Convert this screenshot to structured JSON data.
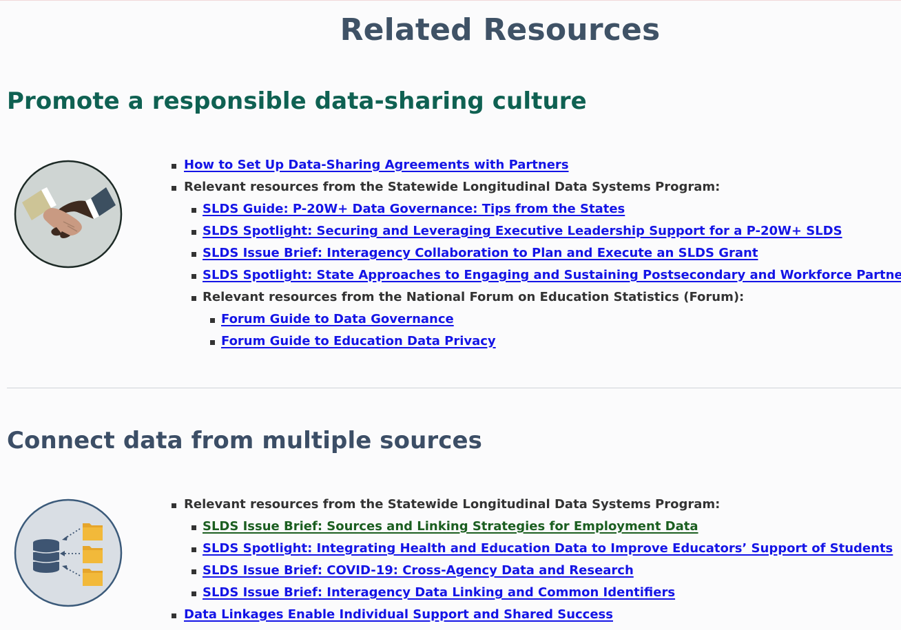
{
  "page": {
    "title": "Related Resources"
  },
  "section1": {
    "heading": "Promote a responsible data-sharing culture",
    "icon": "handshake-icon",
    "items": [
      "How to Set Up Data-Sharing Agreements with Partners",
      "Relevant resources from the Statewide Longitudinal Data Systems Program:",
      "SLDS Guide: P-20W+ Data Governance: Tips from the States",
      "SLDS Spotlight: Securing and Leveraging Executive Leadership Support for a P-20W+ SLDS",
      "SLDS Issue Brief: Interagency Collaboration to Plan and Execute an SLDS Grant",
      "SLDS Spotlight: State Approaches to Engaging and Sustaining Postsecondary and Workforce Partners",
      "Relevant resources from the National Forum on Education Statistics (Forum):",
      "Forum Guide to Data Governance",
      "Forum Guide to Education Data Privacy"
    ]
  },
  "section2": {
    "heading": "Connect data from multiple sources",
    "icon": "database-folders-icon",
    "items": [
      "Relevant resources from the Statewide Longitudinal Data Systems Program:",
      "SLDS Issue Brief: Sources and Linking Strategies for Employment Data",
      "SLDS Spotlight: Integrating Health and Education Data to Improve Educators’ Support of Students",
      "SLDS Issue Brief: COVID-19: Cross-Agency Data and Research",
      "SLDS Issue Brief: Interagency Data Linking and Common Identifiers",
      "Data Linkages Enable Individual Support and Shared Success"
    ]
  },
  "colors": {
    "title": "#3f5266",
    "section1_heading": "#0f6152",
    "section2_heading": "#3c4e66",
    "link": "#1414e6",
    "visited_link": "#1b5e20"
  }
}
